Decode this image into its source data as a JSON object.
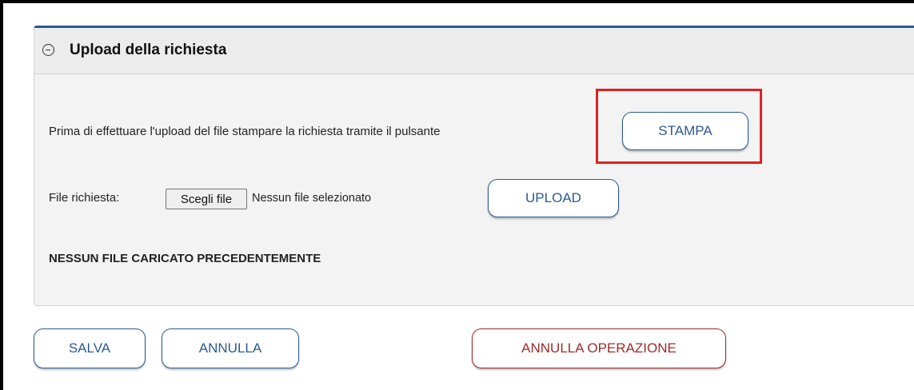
{
  "panel": {
    "title": "Upload della richiesta",
    "collapse_icon": "minus-circle-icon"
  },
  "print_row": {
    "text": "Prima di effettuare l'upload del file stampare la richiesta tramite il pulsante",
    "button_label": "STAMPA"
  },
  "file_row": {
    "label": "File richiesta:",
    "choose_button_label": "Scegli file",
    "file_status": "Nessun file selezionato",
    "upload_button_label": "UPLOAD"
  },
  "no_file_message": "NESSUN FILE CARICATO PRECEDENTEMENTE",
  "footer": {
    "save_label": "SALVA",
    "cancel_label": "ANNULLA",
    "cancel_operation_label": "ANNULLA OPERAZIONE"
  },
  "colors": {
    "accent": "#2a5a8f",
    "danger": "#9e2a2a",
    "highlight": "#e02020"
  }
}
